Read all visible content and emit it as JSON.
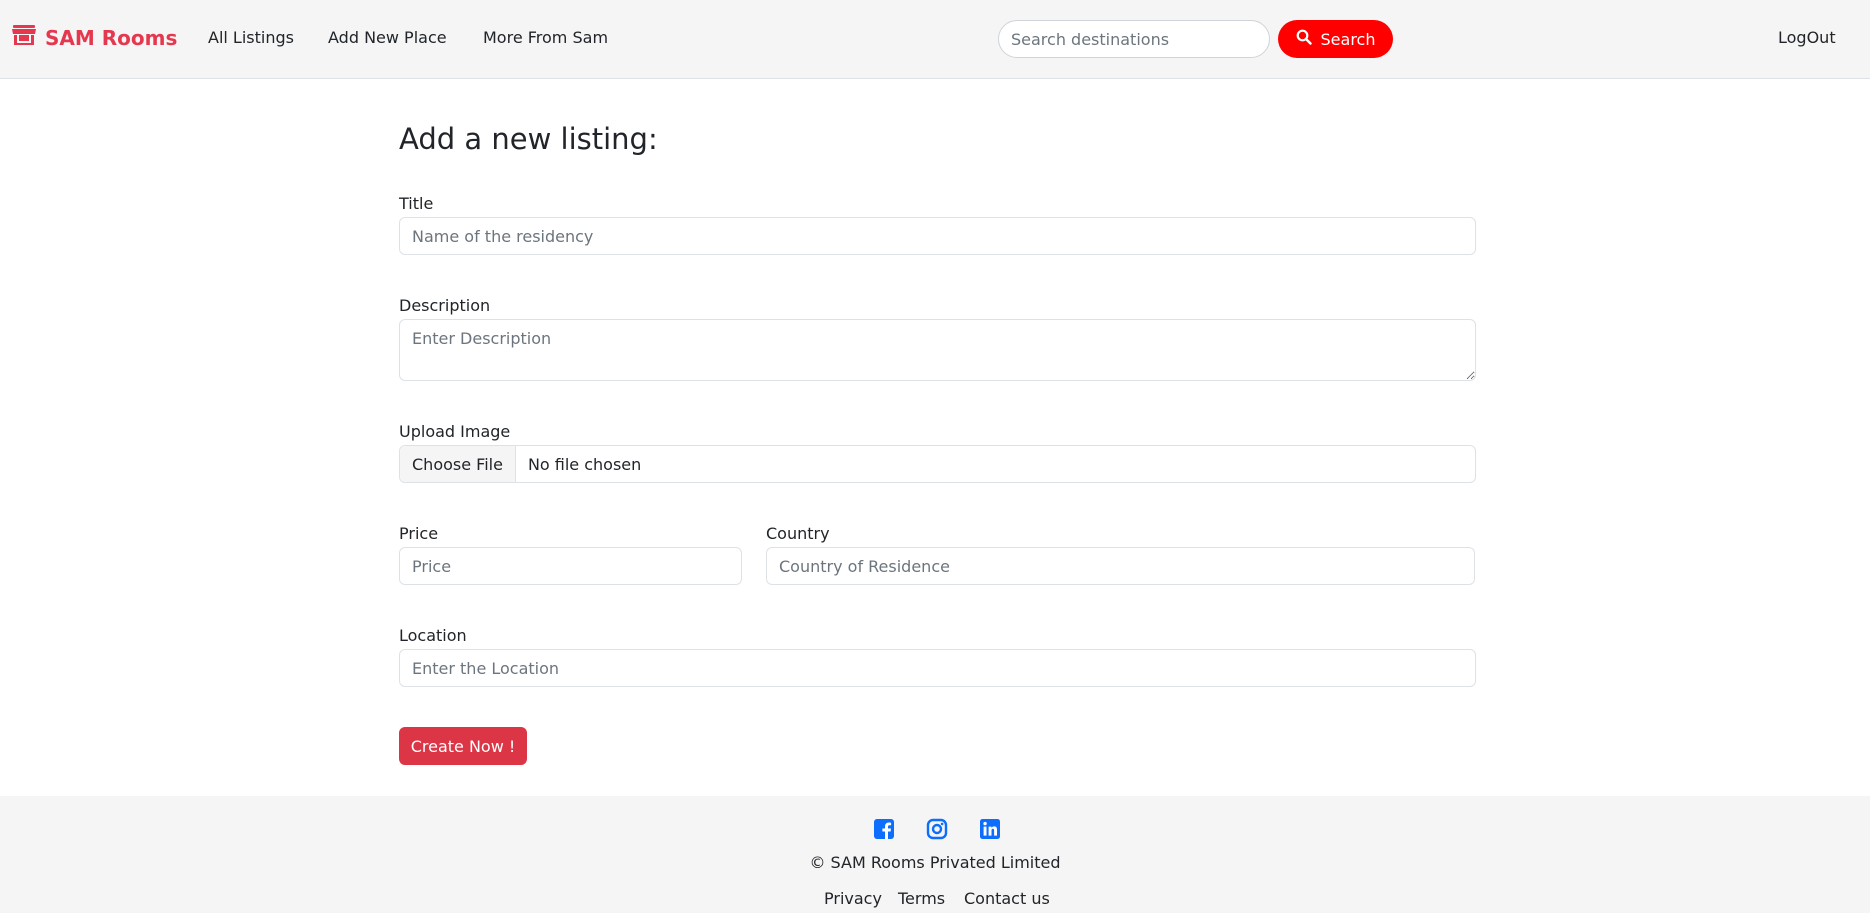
{
  "navbar": {
    "brand_name": "SAM Rooms",
    "brand_icon": "store-icon",
    "links": [
      "All Listings",
      "Add New Place",
      "More From Sam"
    ],
    "search_placeholder": "Search destinations",
    "search_button_label": "Search",
    "logout_label": "LogOut"
  },
  "form": {
    "heading": "Add a new listing:",
    "title_label": "Title",
    "title_placeholder": "Name of the residency",
    "description_label": "Description",
    "description_placeholder": "Enter Description",
    "image_label": "Upload Image",
    "file_button_label": "Choose File",
    "file_status": "No file chosen",
    "price_label": "Price",
    "price_placeholder": "Price",
    "country_label": "Country",
    "country_placeholder": "Country of Residence",
    "location_label": "Location",
    "location_placeholder": "Enter the Location",
    "submit_label": "Create Now !"
  },
  "footer": {
    "social_icons": [
      "facebook-icon",
      "instagram-icon",
      "linkedin-icon"
    ],
    "copyright": "© SAM Rooms Privated Limited",
    "links": [
      "Privacy",
      "Terms",
      "Contact us"
    ]
  },
  "colors": {
    "brand": "#e5384f",
    "search_button": "#ff0000",
    "submit_button": "#dc3545",
    "social_icon": "#0d6efd"
  }
}
